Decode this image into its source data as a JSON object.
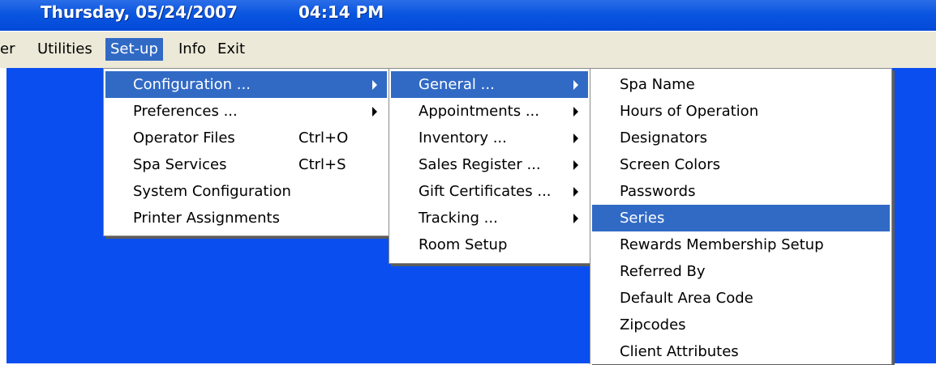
{
  "titlebar": {
    "date": "Thursday, 05/24/2007",
    "time": "04:14 PM"
  },
  "menubar": {
    "items": [
      {
        "label": "er"
      },
      {
        "label": "Utilities"
      },
      {
        "label": "Set-up"
      },
      {
        "label": "Info"
      },
      {
        "label": "Exit"
      }
    ],
    "active": "Set-up"
  },
  "setup_menu": {
    "items": [
      {
        "label": "Configuration ...",
        "shortcut": "",
        "submenu": true
      },
      {
        "label": "Preferences ...",
        "shortcut": "",
        "submenu": true
      },
      {
        "label": "Operator Files",
        "shortcut": "Ctrl+O",
        "submenu": false
      },
      {
        "label": "Spa Services",
        "shortcut": "Ctrl+S",
        "submenu": false
      },
      {
        "label": "System Configuration",
        "shortcut": "",
        "submenu": false
      },
      {
        "label": "Printer Assignments",
        "shortcut": "",
        "submenu": false
      }
    ],
    "highlighted": "Configuration ..."
  },
  "configuration_menu": {
    "items": [
      {
        "label": "General ...",
        "submenu": true
      },
      {
        "label": "Appointments ...",
        "submenu": true
      },
      {
        "label": "Inventory ...",
        "submenu": true
      },
      {
        "label": "Sales Register ...",
        "submenu": true
      },
      {
        "label": "Gift Certificates ...",
        "submenu": true
      },
      {
        "label": "Tracking ...",
        "submenu": true
      },
      {
        "label": "Room Setup",
        "submenu": false
      }
    ],
    "highlighted": "General ..."
  },
  "general_menu": {
    "items": [
      {
        "label": "Spa Name"
      },
      {
        "label": "Hours of Operation"
      },
      {
        "label": "Designators"
      },
      {
        "label": "Screen Colors"
      },
      {
        "label": "Passwords"
      },
      {
        "label": "Series"
      },
      {
        "label": "Rewards Membership Setup"
      },
      {
        "label": "Referred By"
      },
      {
        "label": "Default Area Code"
      },
      {
        "label": "Zipcodes"
      },
      {
        "label": "Client Attributes"
      }
    ],
    "highlighted": "Series"
  },
  "colors": {
    "highlight": "#316ac5",
    "workspace": "#0a4ef0",
    "menubar": "#ece9d8"
  }
}
